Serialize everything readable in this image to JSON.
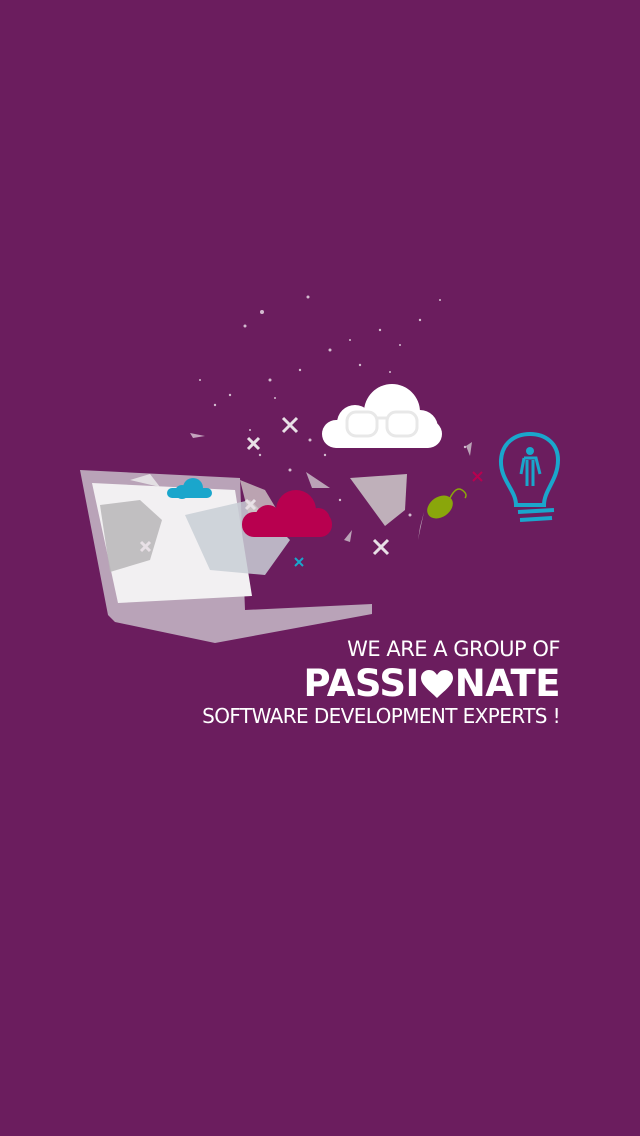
{
  "splash": {
    "background_color": "#6b1d5e",
    "line1": "WE ARE A GROUP OF",
    "line2_prefix": "PASSI",
    "line2_suffix": "NATE",
    "line2_heart_icon": "heart-icon",
    "line3": "SOFTWARE DEVELOPMENT EXPERTS !",
    "colors": {
      "cyan": "#1aa6cc",
      "crimson": "#b8004f",
      "lime": "#8aa60b",
      "white": "#ffffff",
      "laptop": "#b9a3b8"
    }
  }
}
